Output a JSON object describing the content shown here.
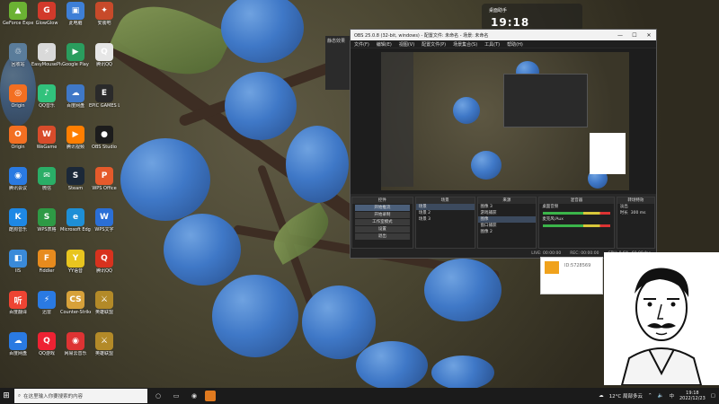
{
  "desktop": {
    "icons": [
      {
        "label": "GeForce Experience",
        "symbol": "▲",
        "color": "#6bb233"
      },
      {
        "label": "GlowGlow",
        "symbol": "G",
        "color": "#d23a2b"
      },
      {
        "label": "此电脑",
        "symbol": "▣",
        "color": "#3e7fd6"
      },
      {
        "label": "安装吧",
        "symbol": "✦",
        "color": "#c74a2a"
      },
      {
        "label": "回收站",
        "symbol": "♲",
        "color": "#5a7c9a"
      },
      {
        "label": "EasyMousePlus",
        "symbol": "⚡",
        "color": "#d9d9d9"
      },
      {
        "label": "Google Play",
        "symbol": "▶",
        "color": "#2a9d5e"
      },
      {
        "label": "腾讯QQ",
        "symbol": "Q",
        "color": "#e6e6e6"
      },
      {
        "label": "Origin",
        "symbol": "◎",
        "color": "#f36f21"
      },
      {
        "label": "QQ音乐",
        "symbol": "♪",
        "color": "#31c27c"
      },
      {
        "label": "百度网盘",
        "symbol": "☁",
        "color": "#3f78c7"
      },
      {
        "label": "EPIC GAMES Launcher",
        "symbol": "E",
        "color": "#2a2a2a"
      },
      {
        "label": "Origin",
        "symbol": "O",
        "color": "#f36f21"
      },
      {
        "label": "WeGame",
        "symbol": "W",
        "color": "#d84c2b"
      },
      {
        "label": "腾讯视频",
        "symbol": "▶",
        "color": "#ff7e00"
      },
      {
        "label": "OBS Studio",
        "symbol": "●",
        "color": "#1c1c1c"
      },
      {
        "label": "腾讯会议",
        "symbol": "◉",
        "color": "#2a7ae2"
      },
      {
        "label": "微信",
        "symbol": "✉",
        "color": "#2aae67"
      },
      {
        "label": "Steam",
        "symbol": "S",
        "color": "#1b2838"
      },
      {
        "label": "WPS Office",
        "symbol": "P",
        "color": "#e55a2b"
      },
      {
        "label": "酷狗音乐",
        "symbol": "K",
        "color": "#1e88e5"
      },
      {
        "label": "WPS表格",
        "symbol": "S",
        "color": "#2e9a45"
      },
      {
        "label": "Microsoft Edge",
        "symbol": "e",
        "color": "#1e8fd6"
      },
      {
        "label": "WPS文字",
        "symbol": "W",
        "color": "#2b6fd6"
      },
      {
        "label": "IIS",
        "symbol": "◧",
        "color": "#3a8ad9"
      },
      {
        "label": "Fiddler",
        "symbol": "F",
        "color": "#e78b1e"
      },
      {
        "label": "YY语音",
        "symbol": "Y",
        "color": "#e8c51f"
      },
      {
        "label": "腾讯QQ",
        "symbol": "Q",
        "color": "#d8321e"
      },
      {
        "label": "百度翻译",
        "symbol": "听",
        "color": "#e43"
      },
      {
        "label": "迅雷",
        "symbol": "⚡",
        "color": "#2a7ae2"
      },
      {
        "label": "Counter-Strike: Global Offensive",
        "symbol": "CS",
        "color": "#d7a13a"
      },
      {
        "label": "英雄联盟",
        "symbol": "⚔",
        "color": "#b38a28"
      },
      {
        "label": "百度网盘",
        "symbol": "☁",
        "color": "#2a7ae2"
      },
      {
        "label": "QQ游戏",
        "symbol": "Q",
        "color": "#e23"
      },
      {
        "label": "网易云音乐",
        "symbol": "◉",
        "color": "#d33"
      },
      {
        "label": "英雄联盟",
        "symbol": "⚔",
        "color": "#b38a28"
      }
    ]
  },
  "widget": {
    "title": "桌面助手",
    "time": "19:18"
  },
  "bg_app": {
    "label": "静态效果"
  },
  "obs": {
    "title": "OBS 25.0.8 (32-bit, windows) - 配置文件: 未命名 - 场景: 未命名",
    "menu": [
      "文件(F)",
      "编辑(E)",
      "视图(V)",
      "配置文件(P)",
      "场景集合(S)",
      "工具(T)",
      "帮助(H)"
    ],
    "docks": {
      "controls_title": "控件",
      "controls": [
        "开始推流",
        "开始录制",
        "工作室模式",
        "设置",
        "退出"
      ],
      "scenes_title": "场景",
      "scenes": [
        "场景",
        "场景 2",
        "场景 3"
      ],
      "sources_title": "来源",
      "sources": [
        "图像 3",
        "游戏捕获",
        "图像",
        "窗口捕获",
        "图像 2"
      ],
      "mixer_title": "混音器",
      "mixer": [
        "桌面音频",
        "麦克风/Aux"
      ],
      "transitions_title": "转场特效",
      "transition_value": "淡出",
      "duration_label": "时长",
      "duration_value": "300 ms"
    },
    "status": [
      "LIVE: 00:00:00",
      "REC: 00:00:00",
      "CPU: 0.6%, 60.00 fps"
    ]
  },
  "card": {
    "text": "ID:5728569"
  },
  "taskbar": {
    "search_placeholder": "在这里输入你要搜索的内容",
    "weather": "12°C 局部多云",
    "time": "19:18",
    "date": "2022/12/23",
    "ime": "中"
  }
}
